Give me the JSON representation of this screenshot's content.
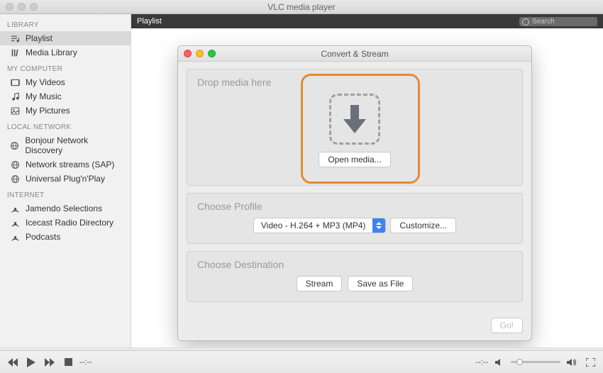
{
  "app_title": "VLC media player",
  "search_placeholder": "Search",
  "content_header": "Playlist",
  "sidebar": {
    "sections": [
      {
        "header": "LIBRARY",
        "items": [
          {
            "label": "Playlist",
            "icon": "playlist-icon",
            "selected": true
          },
          {
            "label": "Media Library",
            "icon": "library-icon"
          }
        ]
      },
      {
        "header": "MY COMPUTER",
        "items": [
          {
            "label": "My Videos",
            "icon": "video-icon"
          },
          {
            "label": "My Music",
            "icon": "music-icon"
          },
          {
            "label": "My Pictures",
            "icon": "pictures-icon"
          }
        ]
      },
      {
        "header": "LOCAL NETWORK",
        "items": [
          {
            "label": "Bonjour Network Discovery",
            "icon": "network-icon"
          },
          {
            "label": "Network streams (SAP)",
            "icon": "network-icon"
          },
          {
            "label": "Universal Plug'n'Play",
            "icon": "network-icon"
          }
        ]
      },
      {
        "header": "INTERNET",
        "items": [
          {
            "label": "Jamendo Selections",
            "icon": "internet-icon"
          },
          {
            "label": "Icecast Radio Directory",
            "icon": "internet-icon"
          },
          {
            "label": "Podcasts",
            "icon": "internet-icon"
          }
        ]
      }
    ]
  },
  "dialog": {
    "title": "Convert & Stream",
    "drop_label": "Drop media here",
    "open_media": "Open media...",
    "profile_label": "Choose Profile",
    "profile_value": "Video - H.264 + MP3 (MP4)",
    "customize": "Customize...",
    "destination_label": "Choose Destination",
    "stream": "Stream",
    "save_as_file": "Save as File",
    "go": "Go!"
  },
  "playbar": {
    "time_elapsed": "--:--",
    "time_total": "--:--"
  }
}
